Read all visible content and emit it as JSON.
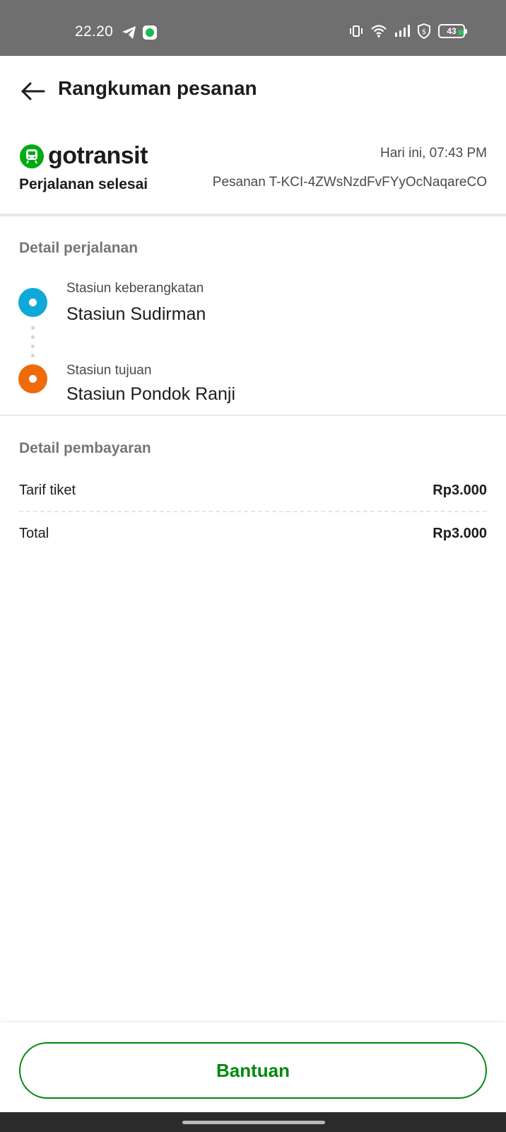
{
  "status_bar": {
    "time": "22.20",
    "battery": "43",
    "icons": [
      "telegram-icon",
      "spotify-icon",
      "vibrate-icon",
      "wifi-icon",
      "signal-icon",
      "vpn-shield-icon",
      "battery-icon"
    ]
  },
  "header": {
    "title": "Rangkuman pesanan",
    "back_icon": "arrow-left-icon"
  },
  "order": {
    "brand": "gotransit",
    "time": "Hari ini, 07:43 PM",
    "status": "Perjalanan selesai",
    "order_id": "Pesanan T-KCI-4ZWsNzdFvFYyOcNaqareCO"
  },
  "trip": {
    "section_title": "Detail perjalanan",
    "origin_label": "Stasiun keberangkatan",
    "origin_name": "Stasiun Sudirman",
    "destination_label": "Stasiun tujuan",
    "destination_name": "Stasiun Pondok Ranji",
    "colors": {
      "origin": "#0fa9d8",
      "destination": "#ee6a0b"
    }
  },
  "payment": {
    "section_title": "Detail pembayaran",
    "fare_label": "Tarif tiket",
    "fare_value": "Rp3.000",
    "total_label": "Total",
    "total_value": "Rp3.000"
  },
  "footer": {
    "help_label": "Bantuan",
    "accent": "#00880d"
  }
}
